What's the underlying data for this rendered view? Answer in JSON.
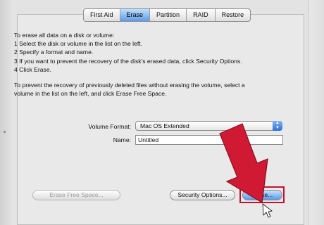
{
  "tabs": [
    "First Aid",
    "Erase",
    "Partition",
    "RAID",
    "Restore"
  ],
  "active_tab": "Erase",
  "instructions": {
    "lines": [
      "To erase all data on a disk or volume:",
      "1 Select the disk or volume in the list on the left.",
      "2 Specify a format and name.",
      "3 If you want to prevent the recovery of the disk's erased data, click Security Options.",
      "4 Click Erase."
    ],
    "free_space": [
      "To prevent the recovery of previously deleted files without erasing the volume, select a",
      "volume in the list on the left, and click Erase Free Space."
    ]
  },
  "form": {
    "volume_format_label": "Volume Format:",
    "volume_format_value": "Mac OS Extended",
    "name_label": "Name:",
    "name_value": "Untitled"
  },
  "buttons": {
    "erase_free_space": "Erase Free Space...",
    "security_options": "Security Options...",
    "erase": "Erase..."
  },
  "colors": {
    "highlight": "#c0142e",
    "arrow": "#d01a34",
    "active_tab": "#5c9bea"
  }
}
